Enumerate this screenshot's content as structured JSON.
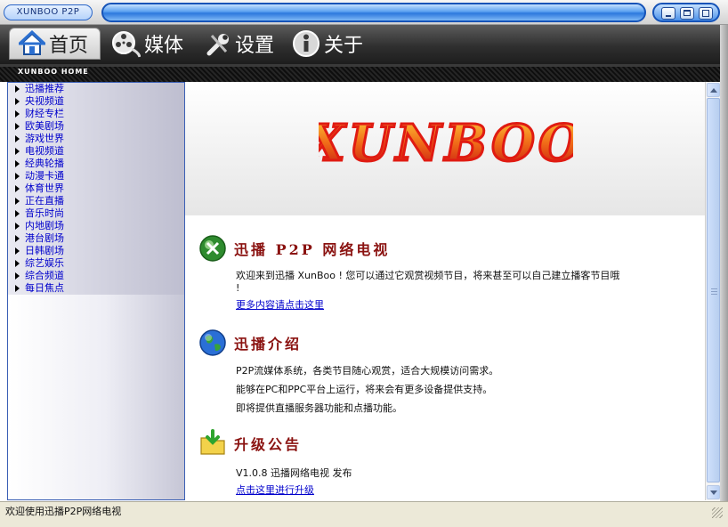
{
  "window": {
    "app_title": "XUNBOO P2P",
    "controls": [
      "minimize",
      "maximize",
      "close"
    ]
  },
  "tabs": [
    {
      "id": "home",
      "label": "首页",
      "icon": "home-icon",
      "active": true
    },
    {
      "id": "media",
      "label": "媒体",
      "icon": "film-reel-icon",
      "active": false
    },
    {
      "id": "settings",
      "label": "设置",
      "icon": "wrench-icon",
      "active": false
    },
    {
      "id": "about",
      "label": "关于",
      "icon": "info-icon",
      "active": false
    }
  ],
  "home_strip": {
    "label": "XUNBOO HOME"
  },
  "sidebar": {
    "items": [
      {
        "label": "迅播推荐"
      },
      {
        "label": "央视频道"
      },
      {
        "label": "财经专栏"
      },
      {
        "label": "欧美剧场"
      },
      {
        "label": "游戏世界"
      },
      {
        "label": "电视频道"
      },
      {
        "label": "经典轮播"
      },
      {
        "label": "动漫卡通"
      },
      {
        "label": "体育世界"
      },
      {
        "label": "正在直播"
      },
      {
        "label": "音乐时尚"
      },
      {
        "label": "内地剧场"
      },
      {
        "label": "港台剧场"
      },
      {
        "label": "日韩剧场"
      },
      {
        "label": "综艺娱乐"
      },
      {
        "label": "综合频道"
      },
      {
        "label": "每日焦点"
      }
    ]
  },
  "content": {
    "logo_text": "XUNBOO",
    "sections": [
      {
        "title": "迅播 P2P 网络电视",
        "icon": "green-x-icon",
        "lines": [
          "欢迎来到迅播 XunBoo ! 您可以通过它观赏视频节目，将来甚至可以自己建立播客节目哦",
          "!"
        ],
        "link": "更多内容请点击这里"
      },
      {
        "title": "迅播介绍",
        "icon": "globe-icon",
        "lines": [
          "P2P流媒体系统，各类节目随心观赏，适合大规模访问需求。",
          "能够在PC和PPC平台上运行，将来会有更多设备提供支持。",
          "即将提供直播服务器功能和点播功能。"
        ]
      },
      {
        "title": "升级公告",
        "icon": "download-folder-icon",
        "lines": [
          "V1.0.8  迅播网络电视 发布"
        ],
        "link": "点击这里进行升级"
      }
    ]
  },
  "status_bar": {
    "text": "欢迎使用迅播P2P网络电视"
  },
  "colors": {
    "title_blue": "#2c78dd",
    "tab_bar": "#2f2f2f",
    "nav_link": "#0000cc",
    "section_title": "#8a1210",
    "logo_fire": "#e8381c"
  }
}
